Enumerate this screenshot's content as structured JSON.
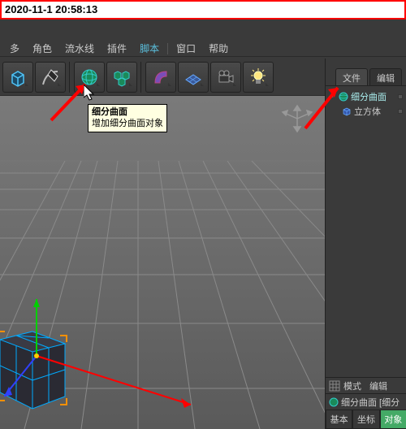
{
  "timestamp": "2020-11-1 20:58:13",
  "menu": {
    "items": [
      "多",
      "角色",
      "流水线",
      "插件",
      "脚本",
      "窗口",
      "帮助"
    ],
    "highlight_index": 4
  },
  "tooltip": {
    "title": "细分曲面",
    "desc": "增加细分曲面对象"
  },
  "right": {
    "tabs": [
      "文件",
      "编辑"
    ],
    "active": 0,
    "items": [
      {
        "name": "细分曲面",
        "icon": "sphere-icon",
        "selected": true,
        "expand": "-"
      },
      {
        "name": "立方体",
        "icon": "cube-icon",
        "selected": false,
        "expand": ""
      }
    ]
  },
  "bottom": {
    "row1": [
      "模式",
      "编辑"
    ],
    "objlabel": "细分曲面 [细分",
    "tabs": [
      "基本",
      "坐标",
      "对象"
    ],
    "active": 2
  },
  "toolbar_icons": [
    "cube-prim-icon",
    "spline-pen-icon",
    "sep",
    "subdiv-sphere-icon",
    "multi-cube-icon",
    "sep",
    "bend-icon",
    "floor-icon",
    "camera-icon",
    "light-icon"
  ]
}
